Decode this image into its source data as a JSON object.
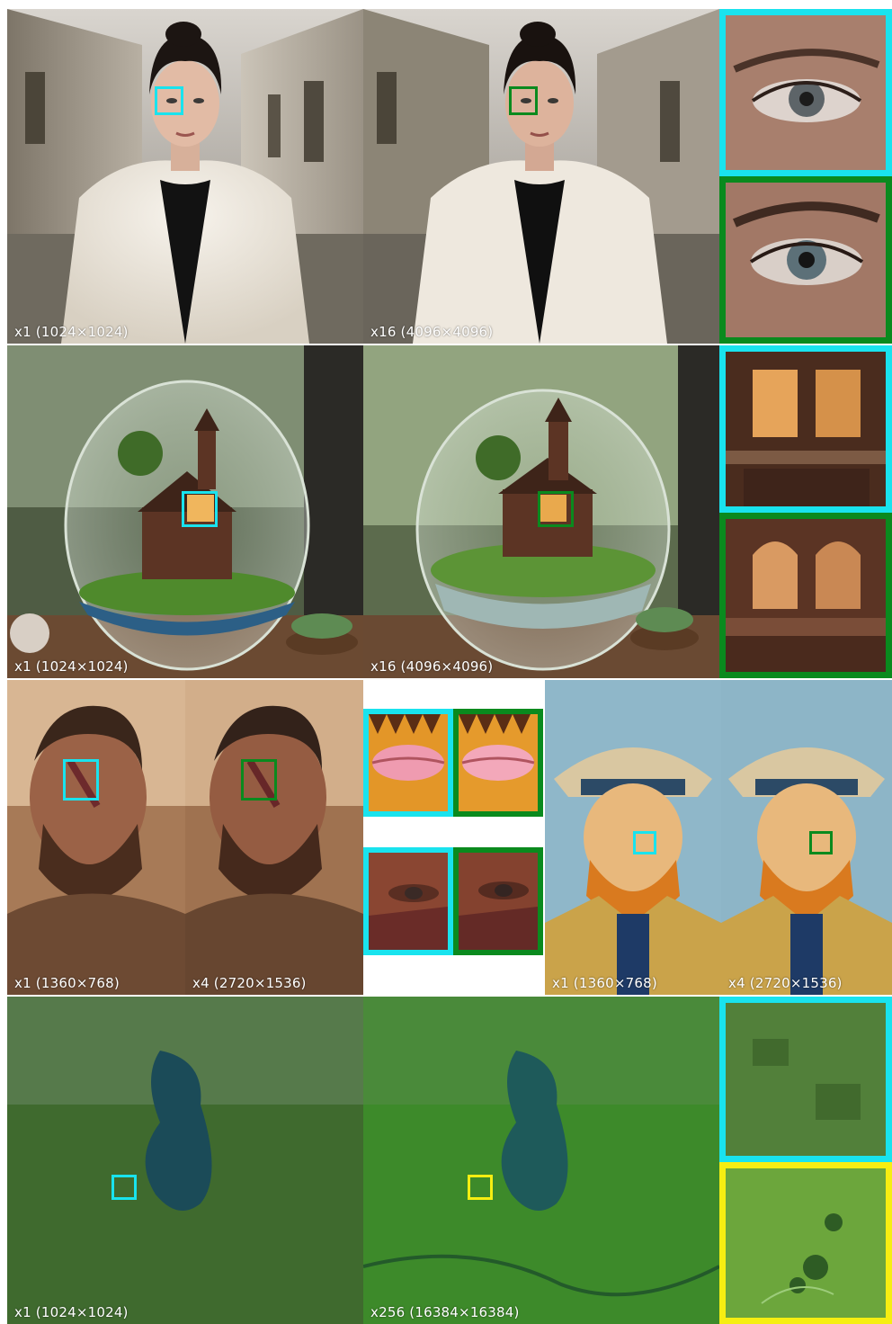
{
  "colors": {
    "cyan": "#19e3ee",
    "green": "#0a8a1e",
    "yellow": "#f6ee12"
  },
  "rows": [
    {
      "scene": "woman-in-white-fur-coat",
      "left_label": "x1 (1024×1024)",
      "right_label": "x16 (4096×4096)",
      "crop_top_color": "cyan",
      "crop_bottom_color": "green"
    },
    {
      "scene": "glass-terrarium-with-house",
      "left_label": "x1 (1024×1024)",
      "right_label": "x16 (4096×4096)",
      "crop_top_color": "cyan",
      "crop_bottom_color": "green"
    },
    {
      "scene": "warrior-and-mosaic-portrait",
      "warrior_left_label": "x1 (1360×768)",
      "warrior_right_label": "x4 (2720×1536)",
      "mosaic_left_label": "x1 (1360×768)",
      "mosaic_right_label": "x4 (2720×1536)"
    },
    {
      "scene": "aerial-forest-lake",
      "left_label": "x1 (1024×1024)",
      "right_label": "x256 (16384×16384)",
      "crop_top_color": "cyan",
      "crop_bottom_color": "yellow"
    }
  ]
}
